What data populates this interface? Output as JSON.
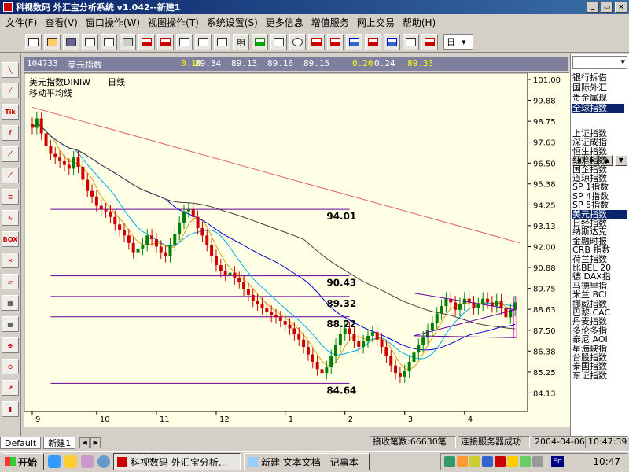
{
  "window": {
    "title": "科视数码 外汇宝分析系统 v1.042--新建1",
    "buttons": [
      "_",
      "▭",
      "×"
    ]
  },
  "menu": [
    "文件(F)",
    "查看(V)",
    "窗口操作(W)",
    "视图操作(T)",
    "系统设置(S)",
    "更多信息",
    "增值服务",
    "网上交易",
    "帮助(H)"
  ],
  "toolbar": {
    "icons": [
      "new-doc-icon",
      "open-folder-icon",
      "save-icon",
      "copy-icon",
      "paste-icon",
      "print-icon",
      "chart-icon",
      "window-icon",
      "list-icon",
      "table-icon",
      "window2-icon",
      "text-icon",
      "pointer-icon",
      "grid-icon",
      "clock-icon",
      "draw-icon",
      "arrow-icon",
      "crosshair-icon",
      "zoom-icon",
      "layout-icon",
      "period-icon",
      "star-icon"
    ],
    "toolbar_text": [
      "明",
      "日"
    ],
    "period_value": "日"
  },
  "left_tools": {
    "icons": [
      "line-tool-icon",
      "fan-tool-icon",
      "tik-icon",
      "parallel-tool-icon",
      "channel-tool-icon",
      "gann-tool-icon",
      "fib-tool-icon",
      "wave-tool-icon",
      "box-icon",
      "delete-icon",
      "eraser-icon",
      "chart-a-icon",
      "chart-b-icon",
      "add-icon",
      "minus-icon",
      "trend-icon",
      "candle-icon"
    ],
    "labels": [
      "Tik",
      "BOX"
    ]
  },
  "quote": {
    "code": "104733",
    "name": "美元指数",
    "values": [
      "0.18",
      "89.34",
      "89.13",
      "89.16",
      "89.15",
      "0.20",
      "0.24",
      "89.33"
    ],
    "value_highlight": [
      true,
      false,
      false,
      false,
      false,
      true,
      false,
      true
    ]
  },
  "chart": {
    "title": "美元指数DINIW",
    "period": "日线",
    "indicator": "移动平均线",
    "colors": {
      "bg": "#ffffe6",
      "up": "#008000",
      "down": "#cc0000",
      "ma_long": "#404040",
      "ma_mid": "#0000cc",
      "ma_short": "#00aaee",
      "ma_fast": "#e0a000",
      "trend": "#e06060",
      "levels": "#660099"
    }
  },
  "chart_data": {
    "type": "line",
    "title": "",
    "x_tick_labels": [
      "9",
      "10",
      "11",
      "12",
      "1",
      "2",
      "3",
      "4"
    ],
    "y_tick_labels": [
      "101.00",
      "99.88",
      "98.75",
      "97.63",
      "96.50",
      "95.38",
      "94.25",
      "93.13",
      "92.00",
      "90.88",
      "89.75",
      "88.63",
      "87.50",
      "86.38",
      "85.25",
      "84.13"
    ],
    "ylim": [
      83.13,
      101.0
    ],
    "horizontal_levels": [
      94.01,
      90.43,
      89.32,
      88.22,
      84.64
    ],
    "series": [
      {
        "type": "ohlc",
        "values": [
          98.4,
          98.9,
          98.1,
          97.4,
          97.0,
          96.8,
          96.6,
          96.4,
          96.2,
          96.8,
          96.3,
          95.6,
          95.0,
          94.7,
          94.2,
          94.0,
          93.9,
          93.6,
          93.2,
          92.9,
          92.6,
          92.2,
          91.7,
          91.9,
          92.1,
          92.6,
          92.4,
          92.0,
          91.7,
          91.5,
          92.1,
          92.7,
          93.3,
          93.9,
          94.0,
          93.6,
          93.0,
          92.6,
          92.1,
          91.5,
          91.0,
          90.7,
          90.5,
          90.6,
          90.3,
          90.1,
          89.7,
          89.4,
          89.1,
          88.9,
          88.7,
          88.5,
          88.3,
          88.2,
          88.0,
          87.8,
          87.6,
          87.3,
          87.0,
          86.6,
          86.2,
          85.8,
          85.4,
          85.2,
          85.5,
          86.1,
          86.7,
          87.3,
          87.6,
          87.3,
          86.9,
          86.6,
          86.9,
          87.2,
          87.4,
          87.0,
          86.6,
          86.1,
          85.6,
          85.2,
          85.0,
          85.3,
          85.8,
          86.3,
          86.7,
          87.1,
          87.5,
          87.9,
          88.4,
          88.8,
          89.2,
          89.0,
          88.6,
          88.9,
          89.2,
          89.0,
          88.7,
          88.9,
          89.2,
          89.0,
          88.8,
          89.1,
          88.7,
          88.2,
          88.6,
          89.0
        ]
      },
      {
        "name": "",
        "type": "ma",
        "period": 5
      },
      {
        "name": "",
        "type": "ma",
        "period": 10
      },
      {
        "name": "",
        "type": "ma",
        "period": 30
      },
      {
        "name": "",
        "type": "ma",
        "period": 60
      }
    ]
  },
  "right_panel": {
    "categories": [
      "银行拆借",
      "国际外汇",
      "贵金属现",
      "全球指数"
    ],
    "selected_category": 3,
    "arrows": [
      "◀",
      "▶",
      "▲",
      "▼"
    ],
    "items": [
      "上证指数",
      "深证成指",
      "恒生指数",
      "红筹指数",
      "国企指数",
      "道琼指数",
      "SP 1指数",
      "SP 4指数",
      "SP 5指数",
      "美元指数",
      "日经指数",
      "纳斯达克",
      "金融时报",
      "CRB 指数",
      "荷兰指数",
      "比BEL 20",
      "德 DAX指",
      "马德里指",
      "米兰 BCI",
      "挪威指数",
      "巴黎 CAC",
      "丹麦指数",
      "多伦多指",
      "泰尼 AOI",
      "星海峡指",
      "台股指数",
      "泰国指数",
      "东证指数"
    ],
    "selected_item": 9
  },
  "tabs": {
    "items": [
      "Default",
      "新建1"
    ],
    "arrows": [
      "◀",
      "▶"
    ]
  },
  "status": {
    "count_label": "接收笔数:66630笔",
    "connection": "连接服务器成功",
    "date": "2004-04-06",
    "time": "10:47:39"
  },
  "taskbar": {
    "start_label": "开始",
    "tasks": [
      "科视数码 外汇宝分析...",
      "新建 文本文档 - 记事本"
    ],
    "active_task": 0,
    "tray_lang": "En",
    "clock": "10:47"
  }
}
